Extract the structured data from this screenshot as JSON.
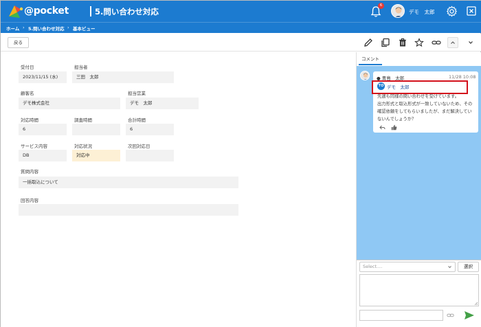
{
  "header": {
    "logo_text": "@pocket",
    "page_title": "5.問い合わせ対応",
    "notification_count": "6",
    "user_name": "デモ　太郎"
  },
  "breadcrumb": [
    "ホーム",
    "5.問い合わせ対応",
    "基本ビュー"
  ],
  "breadcrumb_sep": "›",
  "toolbar": {
    "back_label": "戻る",
    "icons": [
      "pencil-icon",
      "copy-icon",
      "trash-icon",
      "star-icon",
      "link-icon",
      "collapse-icon",
      "chevron-down-icon"
    ]
  },
  "form": {
    "received_date": {
      "label": "受付日",
      "value": "2023/11/15 (水)"
    },
    "assignee": {
      "label": "担当者",
      "value": "三田　太郎"
    },
    "customer": {
      "label": "顧客名",
      "value": "デモ株式会社"
    },
    "sales_rep": {
      "label": "担当営業",
      "value": "デモ　太郎"
    },
    "handling_time": {
      "label": "対応時間",
      "value": "6"
    },
    "research_time": {
      "label": "調査時間",
      "value": ""
    },
    "total_time": {
      "label": "合計時間",
      "value": "6"
    },
    "service": {
      "label": "サービス内容",
      "value": "DB"
    },
    "status": {
      "label": "対応状況",
      "value": "対応中"
    },
    "next_date": {
      "label": "次回対応日",
      "value": ""
    },
    "question": {
      "label": "質問内容",
      "value": "一括取込について"
    },
    "answer": {
      "label": "回答内容",
      "value": ""
    }
  },
  "comments_panel": {
    "tab_label": "コメント",
    "comment": {
      "author": "● 青島　太郎",
      "time": "11/28 10:08",
      "to_chip": "TO",
      "to_name": "デモ　太郎",
      "lines": [
        "先週も同様の問い合わせを受けています。",
        "出力形式と取込形式が一致していないため、その",
        "確認依頼をしてもらいましたが、まだ解決してい",
        "ないんでしょうか？"
      ]
    },
    "compose": {
      "select_placeholder": "Select....",
      "select_button": "選択"
    }
  },
  "colors": {
    "brand": "#1c7bd0",
    "comment_bg": "#8fc8f4",
    "highlight_box": "#d3101b",
    "status_fill": "#fdf0d5"
  }
}
